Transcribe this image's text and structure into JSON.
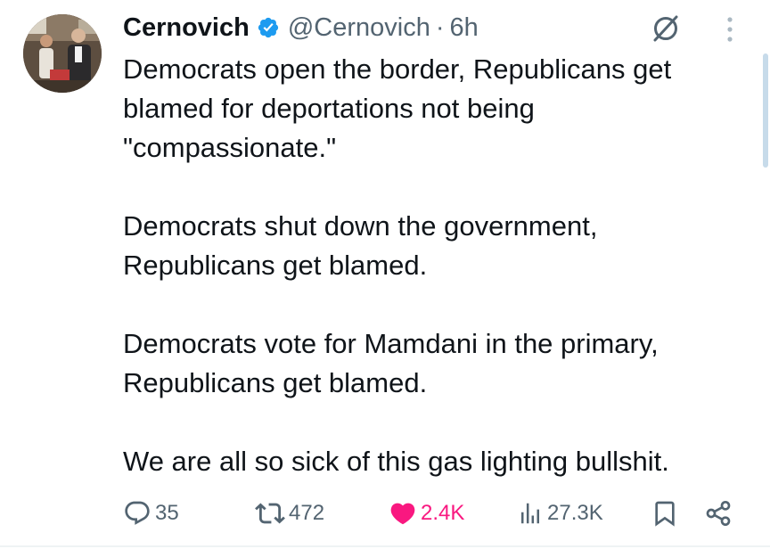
{
  "tweet": {
    "author_name": "Cernovich",
    "handle": "@Cernovich",
    "separator": "·",
    "time": "6h",
    "paragraphs": [
      "Democrats open the border, Republicans get blamed for deportations not being \"compassionate.\"",
      "Democrats shut down the government, Republicans get blamed.",
      "Democrats vote for Mamdani in the primary, Republicans get blamed.",
      "We are all so sick of this gas lighting bullshit."
    ],
    "metrics": {
      "replies": "35",
      "reposts": "472",
      "likes": "2.4K",
      "views": "27.3K"
    },
    "liked": true
  },
  "icons": {
    "verified": "verified-badge-icon",
    "grok": "grok-icon",
    "more": "more-vertical-icon",
    "reply": "reply-icon",
    "repost": "repost-icon",
    "like": "heart-icon",
    "views": "views-icon",
    "bookmark": "bookmark-icon",
    "share": "share-icon"
  },
  "colors": {
    "text": "#0f1419",
    "secondary": "#536471",
    "verified": "#1d9bf0",
    "like": "#f91880"
  }
}
